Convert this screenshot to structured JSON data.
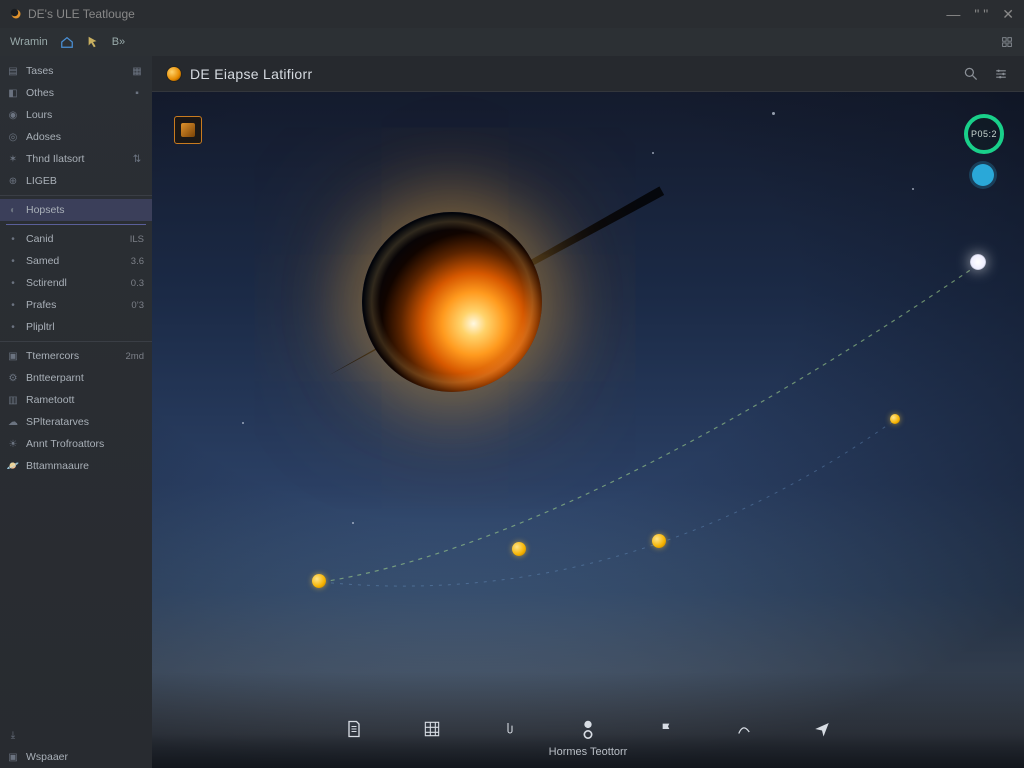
{
  "window": {
    "title": "DE's ULE Teatlouge"
  },
  "toolbar": {
    "home_label": "Wramin",
    "menu_b": "B»"
  },
  "canvas": {
    "title": "DE Eiapse Latifiorr",
    "overlay_button_name": "layer-toggle",
    "badge_ring_label": "P05:2",
    "dock_label": "Hormes Teottorr",
    "dock_items": [
      {
        "name": "document-icon"
      },
      {
        "name": "grid-icon"
      },
      {
        "name": "pointer-icon"
      },
      {
        "name": "target-icon"
      },
      {
        "name": "flag-icon"
      },
      {
        "name": "path-icon"
      },
      {
        "name": "send-icon"
      }
    ]
  },
  "sidebar": {
    "items": [
      {
        "icon": "file-icon",
        "label": "Tases",
        "value": ""
      },
      {
        "icon": "cube-icon",
        "label": "Othes",
        "value": ""
      },
      {
        "icon": "user-icon",
        "label": "Lours",
        "value": ""
      },
      {
        "icon": "target-icon",
        "label": "Adoses",
        "value": ""
      },
      {
        "icon": "atom-icon",
        "label": "Thnd Ilatsort",
        "value": ""
      },
      {
        "icon": "globe-icon",
        "label": "LIGEB",
        "value": ""
      }
    ],
    "stats": [
      {
        "icon": "gauge-icon",
        "label": "Hopsets",
        "value": ""
      },
      {
        "icon": "dot-icon",
        "label": "Canid",
        "value": "ILS"
      },
      {
        "icon": "dot-icon",
        "label": "Samed",
        "value": "3.6"
      },
      {
        "icon": "dot-icon",
        "label": "Sctirendl",
        "value": "0.3"
      },
      {
        "icon": "dot-icon",
        "label": "Prafes",
        "value": "0’3"
      },
      {
        "icon": "dot-icon",
        "label": "Plipltrl",
        "value": ""
      }
    ],
    "links": [
      {
        "icon": "folder-icon",
        "label": "Ttemercors",
        "value": "2md"
      },
      {
        "icon": "gear-icon",
        "label": "Bntteerparnt",
        "value": ""
      },
      {
        "icon": "chip-icon",
        "label": "Rametoott",
        "value": ""
      },
      {
        "icon": "cloud-icon",
        "label": "SPlteratarves",
        "value": ""
      },
      {
        "icon": "sun-icon",
        "label": "Annt Trofroattors",
        "value": ""
      },
      {
        "icon": "planet-icon",
        "label": "Bttammaaure",
        "value": ""
      }
    ],
    "footer": [
      {
        "icon": "export-icon",
        "label": ""
      },
      {
        "icon": "camera-icon",
        "label": "Wspaaer"
      }
    ]
  }
}
